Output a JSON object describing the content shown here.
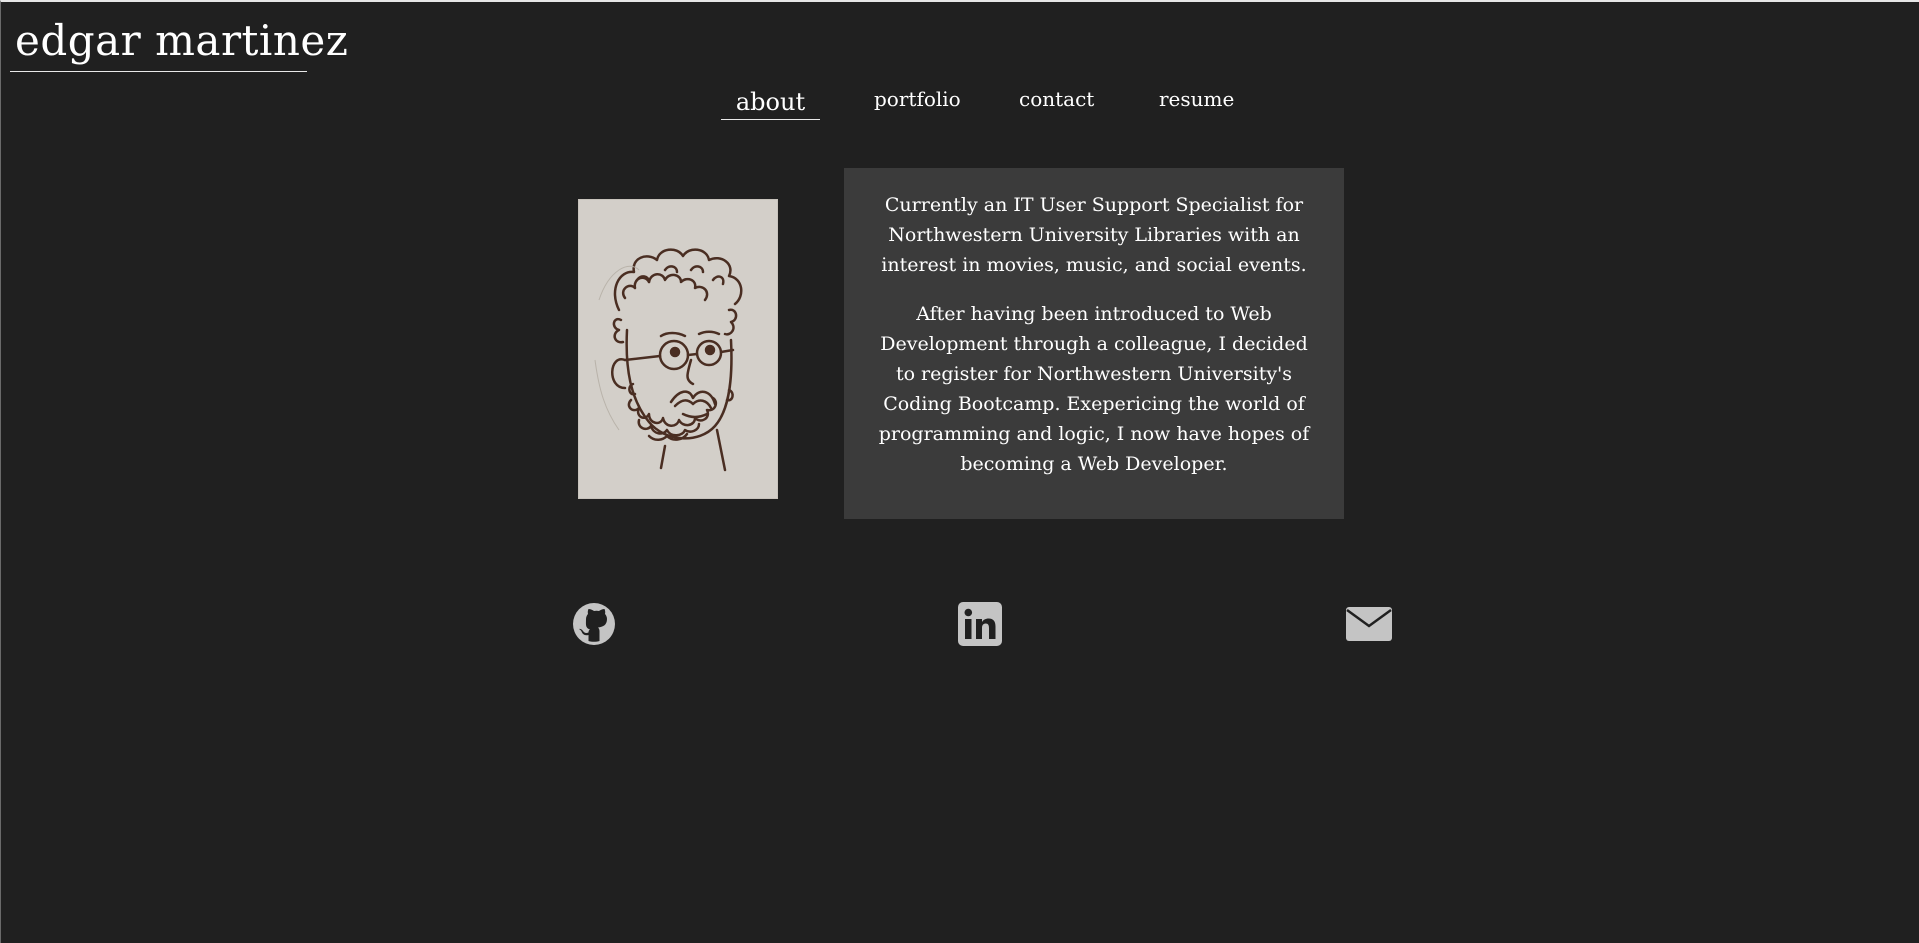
{
  "header": {
    "site_title": "edgar martinez"
  },
  "nav": {
    "items": [
      {
        "label": "about",
        "active": true
      },
      {
        "label": "portfolio",
        "active": false
      },
      {
        "label": "contact",
        "active": false
      },
      {
        "label": "resume",
        "active": false
      }
    ]
  },
  "about": {
    "portrait_icon": "self-portrait-drawing",
    "paragraphs": [
      "Currently an IT User Support Specialist for Northwestern University Libraries with an interest in movies, music, and social events.",
      "After having been introduced to Web Development through a colleague, I decided to register for Northwestern University's Coding Bootcamp. Exepericing the world of programming and logic, I now have hopes of becoming a Web Developer."
    ]
  },
  "social": {
    "icons": [
      "github-icon",
      "linkedin-icon",
      "email-icon"
    ],
    "icon_color": "#c4c4c4"
  },
  "colors": {
    "background": "#202020",
    "panel": "#3b3b3b",
    "text": "#ffffff"
  }
}
